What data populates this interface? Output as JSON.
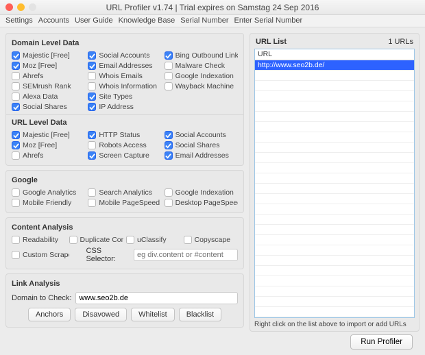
{
  "window": {
    "title": "URL Profiler v1.74 | Trial expires on Samstag 24 Sep 2016"
  },
  "menubar": [
    "Settings",
    "Accounts",
    "User Guide",
    "Knowledge Base",
    "Serial Number",
    "Enter Serial Number"
  ],
  "sections": {
    "domain": {
      "title": "Domain Level Data",
      "items": [
        {
          "label": "Majestic [Free]",
          "on": true
        },
        {
          "label": "Social Accounts",
          "on": true
        },
        {
          "label": "Bing Outbound Links",
          "on": true
        },
        {
          "label": "Moz [Free]",
          "on": true
        },
        {
          "label": "Email Addresses",
          "on": true
        },
        {
          "label": "Malware Check",
          "on": false
        },
        {
          "label": "Ahrefs",
          "on": false
        },
        {
          "label": "Whois Emails",
          "on": false
        },
        {
          "label": "Google Indexation",
          "on": false
        },
        {
          "label": "SEMrush Rank",
          "on": false
        },
        {
          "label": "Whois Information",
          "on": false
        },
        {
          "label": "Wayback Machine",
          "on": false
        },
        {
          "label": "Alexa Data",
          "on": false
        },
        {
          "label": "Site Types",
          "on": true
        },
        {
          "label": "",
          "on": false,
          "blank": true
        },
        {
          "label": "Social Shares",
          "on": true
        },
        {
          "label": "IP Address",
          "on": true
        },
        {
          "label": "",
          "on": false,
          "blank": true
        }
      ]
    },
    "url": {
      "title": "URL Level Data",
      "items": [
        {
          "label": "Majestic [Free]",
          "on": true
        },
        {
          "label": "HTTP Status",
          "on": true
        },
        {
          "label": "Social Accounts",
          "on": true
        },
        {
          "label": "Moz [Free]",
          "on": true
        },
        {
          "label": "Robots Access",
          "on": false
        },
        {
          "label": "Social Shares",
          "on": true
        },
        {
          "label": "Ahrefs",
          "on": false
        },
        {
          "label": "Screen Capture",
          "on": true
        },
        {
          "label": "Email Addresses",
          "on": true
        }
      ]
    },
    "google": {
      "title": "Google",
      "items": [
        {
          "label": "Google Analytics",
          "on": false
        },
        {
          "label": "Search Analytics",
          "on": false
        },
        {
          "label": "Google Indexation",
          "on": false
        },
        {
          "label": "Mobile Friendly",
          "on": false
        },
        {
          "label": "Mobile PageSpeed",
          "on": false
        },
        {
          "label": "Desktop PageSpeed",
          "on": false
        }
      ]
    },
    "content": {
      "title": "Content Analysis",
      "items": [
        {
          "label": "Readability",
          "on": false
        },
        {
          "label": "Duplicate Content",
          "on": false
        },
        {
          "label": "uClassify",
          "on": false
        },
        {
          "label": "Copyscape",
          "on": false
        }
      ],
      "custom_scraper_label": "Custom Scraper",
      "css_selector_label": "CSS Selector:",
      "css_selector_placeholder": "eg div.content or #content",
      "css_selector_value": ""
    },
    "link": {
      "title": "Link Analysis",
      "domain_label": "Domain to Check:",
      "domain_value": "www.seo2b.de",
      "buttons": [
        "Anchors",
        "Disavowed",
        "Whitelist",
        "Blacklist"
      ]
    }
  },
  "urllist": {
    "title": "URL List",
    "count_label": "1 URLs",
    "header": "URL",
    "rows": [
      "http://www.seo2b.de/"
    ],
    "hint": "Right click on the list above to import or add URLs"
  },
  "footer": {
    "run_label": "Run Profiler"
  }
}
